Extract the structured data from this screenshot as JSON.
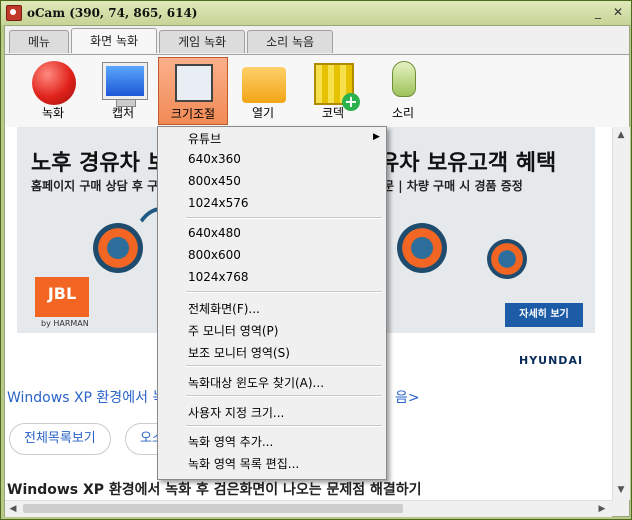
{
  "window": {
    "title": "oCam (390, 74, 865, 614)"
  },
  "tabs": [
    "메뉴",
    "화면 녹화",
    "게임 녹화",
    "소리 녹음"
  ],
  "toolbar": {
    "record_label": "녹화",
    "capture_label": "캡처",
    "resize_label": "크기조절",
    "open_label": "열기",
    "codec_label": "코덱",
    "sound_label": "소리"
  },
  "page": {
    "banner_title": "노후 경유차 보",
    "banner_sub": "홈페이지 구매 상담 후 구매",
    "banner_title_right": "유차 보유고객 혜택",
    "banner_sub_right": "문 | 차량 구매 시 경품 증정",
    "jbl_logo": "JBL",
    "jbl_sub": "by HARMAN",
    "detail_button": "자세히 보기",
    "brand": "HYUNDAI",
    "link_left": "Windows XP 환경에서 녹",
    "link_right": "음>",
    "pill_list": "전체목록보기",
    "pill_second": "오스",
    "heading": "Windows XP 환경에서 녹화 후 검은화면이 나오는 문제점 해결하기"
  },
  "menu": {
    "youtube": "유튜브",
    "r640x360": "640x360",
    "r800x450": "800x450",
    "r1024x576": "1024x576",
    "r640x480": "640x480",
    "r800x600": "800x600",
    "r1024x768": "1024x768",
    "fullscreen": "전체화면(F)...",
    "main_monitor": "주 모니터 영역(P)",
    "secondary_monitor": "보조 모니터 영역(S)",
    "find_window": "녹화대상 윈도우 찾기(A)...",
    "custom_size": "사용자 지정 크기...",
    "add_region": "녹화 영역 추가...",
    "edit_region_list": "녹화 영역 목록 편집..."
  }
}
